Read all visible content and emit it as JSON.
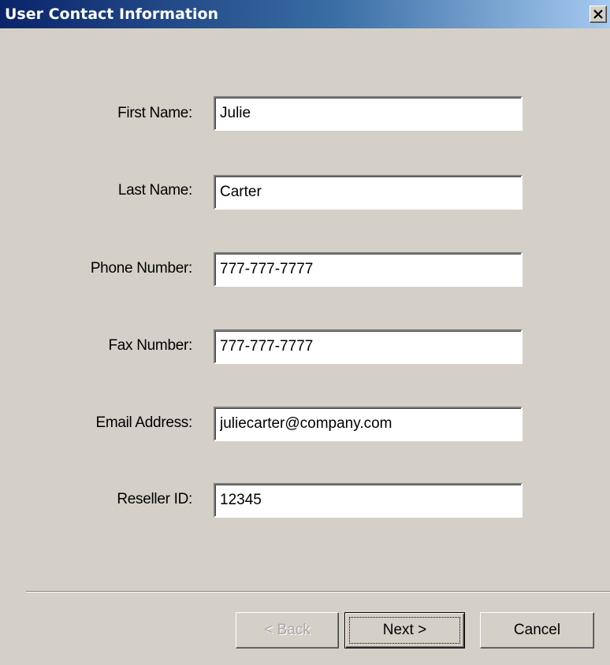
{
  "window": {
    "title": "User Contact Information"
  },
  "icons": {
    "close": "close-icon"
  },
  "colors": {
    "titlebar_start": "#0a246a",
    "titlebar_end": "#a6caf0",
    "dialog_background": "#d4d0c8"
  },
  "form": {
    "fields": [
      {
        "label": "First Name:",
        "value": "Julie"
      },
      {
        "label": "Last Name:",
        "value": "Carter"
      },
      {
        "label": "Phone Number:",
        "value": "777-777-7777"
      },
      {
        "label": "Fax Number:",
        "value": "777-777-7777"
      },
      {
        "label": "Email Address:",
        "value": "juliecarter@company.com"
      },
      {
        "label": "Reseller ID:",
        "value": "12345"
      }
    ]
  },
  "buttons": {
    "back": "< Back",
    "next": "Next >",
    "cancel": "Cancel"
  }
}
